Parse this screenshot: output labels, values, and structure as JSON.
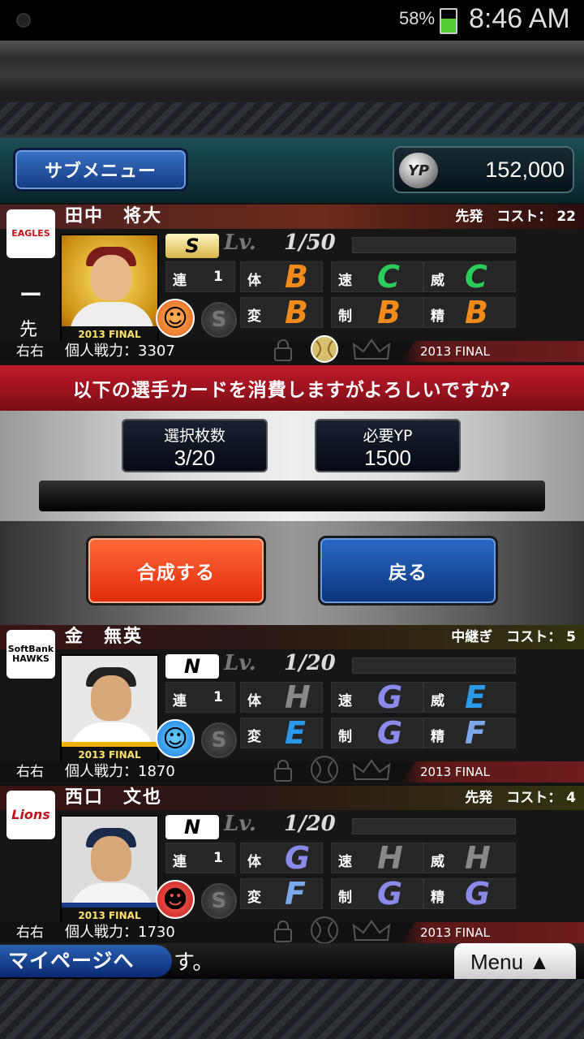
{
  "status": {
    "battery": "58%",
    "time": "8:46 AM"
  },
  "header": {
    "submenu_label": "サブメニュー",
    "yp_icon": "YP",
    "yp_value": "152,000"
  },
  "cards": [
    {
      "name": "田中　将大",
      "position": "先発　コスト：",
      "cost": "22",
      "team": "EAGLES",
      "rank": "S",
      "lv_label": "Lv.",
      "level": "1/50",
      "side_mark": "ー",
      "side_label": "先",
      "photo_label": "2013 FINAL",
      "stats": [
        {
          "label": "連",
          "value": "1"
        },
        {
          "label": "体",
          "value": "B"
        },
        {
          "label": "速",
          "value": "C"
        },
        {
          "label": "威",
          "value": "C"
        },
        {
          "label": "変",
          "value": "B"
        },
        {
          "label": "制",
          "value": "B"
        },
        {
          "label": "精",
          "value": "B"
        }
      ],
      "hand": "右右",
      "power": "個人戦力：3307",
      "edition": "2013 FINAL",
      "face": "smile-orange"
    },
    {
      "name": "金　無英",
      "position": "中継ぎ　コスト：",
      "cost": "5",
      "team": "SoftBank HAWKS",
      "rank": "N",
      "lv_label": "Lv.",
      "level": "1/20",
      "photo_label": "2013 FINAL",
      "stats": [
        {
          "label": "連",
          "value": "1"
        },
        {
          "label": "体",
          "value": "H"
        },
        {
          "label": "速",
          "value": "G"
        },
        {
          "label": "威",
          "value": "E"
        },
        {
          "label": "変",
          "value": "E"
        },
        {
          "label": "制",
          "value": "G"
        },
        {
          "label": "精",
          "value": "F"
        }
      ],
      "hand": "右右",
      "power": "個人戦力：1870",
      "edition": "2013 FINAL",
      "face": "smile-blue"
    },
    {
      "name": "西口　文也",
      "position": "先発　コスト：",
      "cost": "4",
      "team": "Lions",
      "rank": "N",
      "lv_label": "Lv.",
      "level": "1/20",
      "photo_label": "2013 FINAL",
      "stats": [
        {
          "label": "連",
          "value": "1"
        },
        {
          "label": "体",
          "value": "G"
        },
        {
          "label": "速",
          "value": "H"
        },
        {
          "label": "威",
          "value": "H"
        },
        {
          "label": "変",
          "value": "F"
        },
        {
          "label": "制",
          "value": "G"
        },
        {
          "label": "精",
          "value": "G"
        }
      ],
      "hand": "右右",
      "power": "個人戦力：1730",
      "edition": "2013 FINAL",
      "face": "laugh-red"
    }
  ],
  "confirm": {
    "message": "以下の選手カードを消費しますがよろしいですか?",
    "select_title": "選択枚数",
    "select_value": "3/20",
    "yp_title": "必要YP",
    "yp_value": "1500",
    "combine_label": "合成する",
    "back_label": "戻る"
  },
  "footer": {
    "mypage_label": "マイページへ",
    "ticker": "す。",
    "menu_label": "Menu ▲"
  },
  "colors": {
    "B": "#f08a1a",
    "C": "#2ccc5a",
    "E": "#2a9ae8",
    "F": "#7aa8e8",
    "G": "#8a8ae8",
    "H": "#888888"
  }
}
